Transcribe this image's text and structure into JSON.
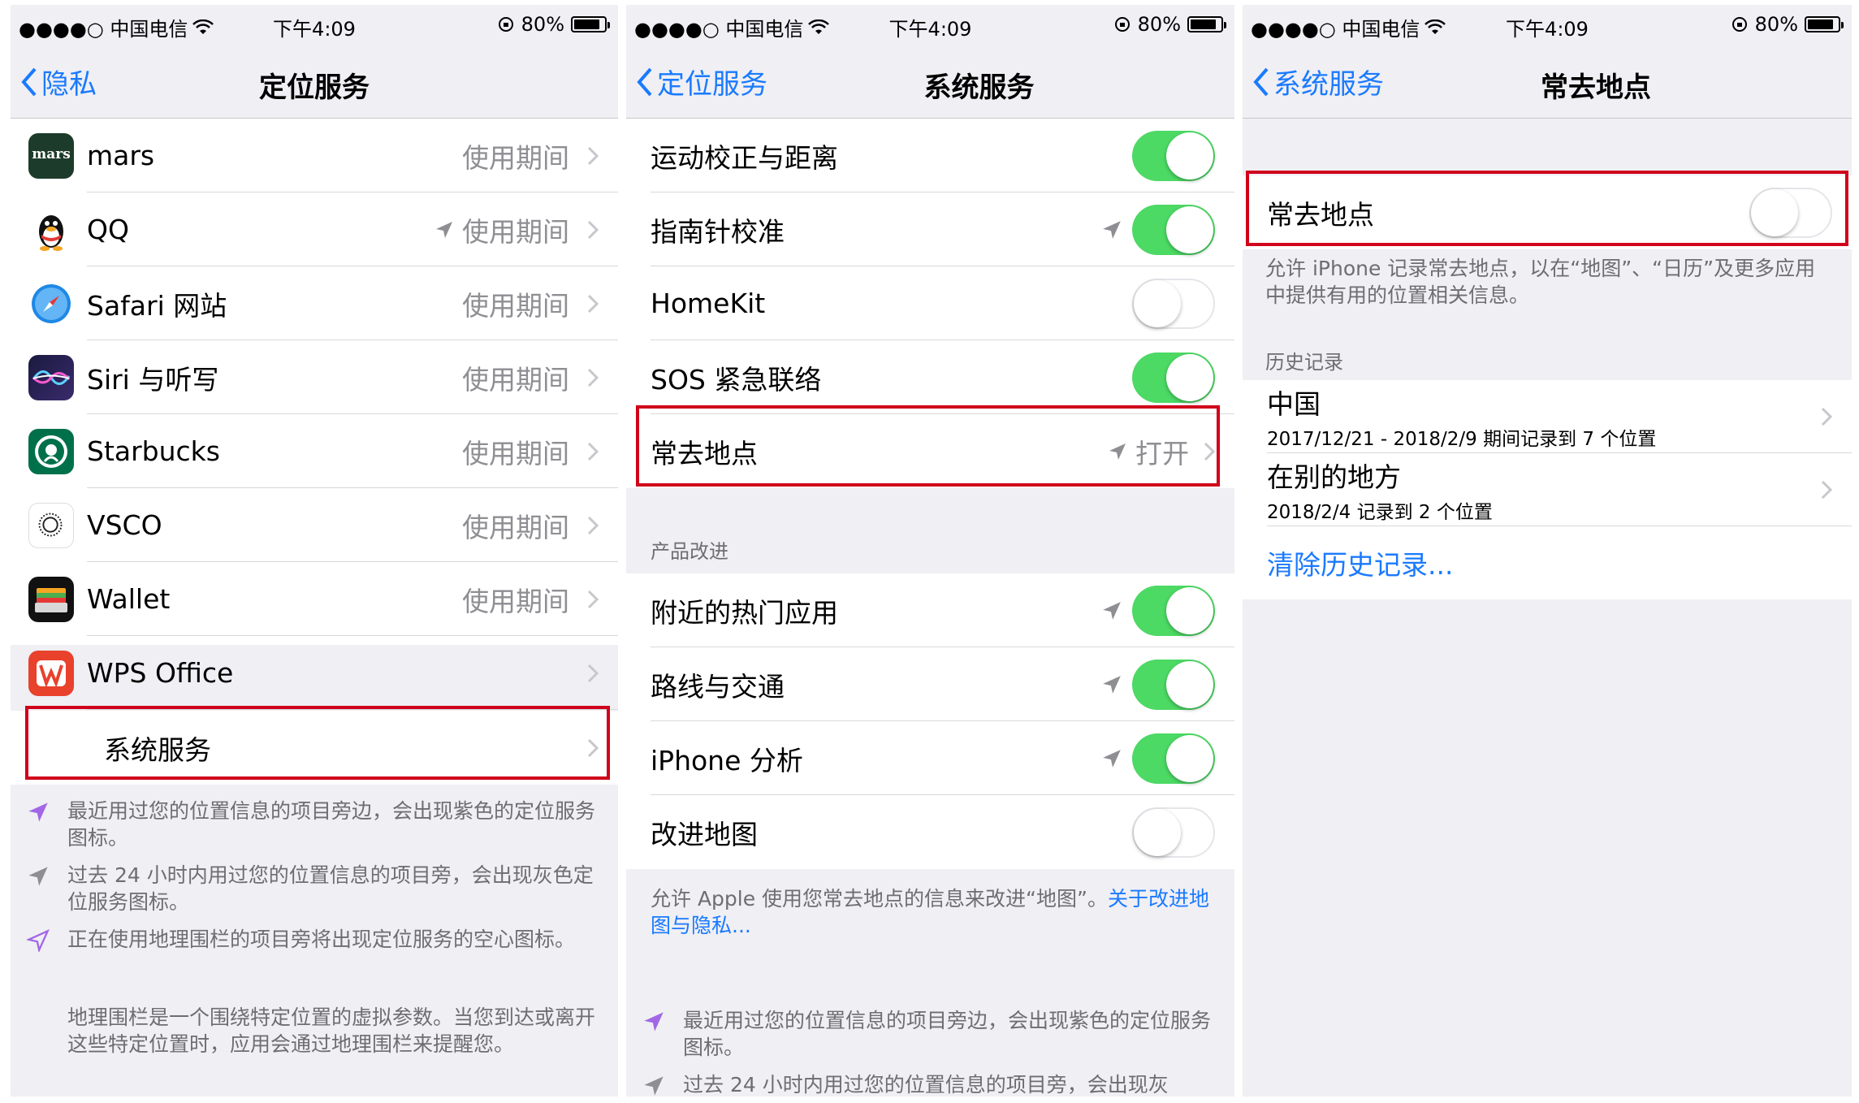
{
  "status": {
    "carrier": "●●●●○ 中国电信",
    "time": "下午4:09",
    "battery": "80%"
  },
  "panel1": {
    "back": "隐私",
    "title": "定位服务",
    "apps": [
      {
        "name": "mars",
        "value": "使用期间",
        "recent": false
      },
      {
        "name": "QQ",
        "value": "使用期间",
        "recent": true
      },
      {
        "name": "Safari 网站",
        "value": "使用期间",
        "recent": false
      },
      {
        "name": "Siri 与听写",
        "value": "使用期间",
        "recent": false
      },
      {
        "name": "Starbucks",
        "value": "使用期间",
        "recent": false
      },
      {
        "name": "VSCO",
        "value": "使用期间",
        "recent": false
      },
      {
        "name": "Wallet",
        "value": "使用期间",
        "recent": false
      },
      {
        "name": "WPS Office",
        "value": "",
        "recent": false
      }
    ],
    "mars_icon_text": "mars",
    "system_services": "系统服务",
    "notes": [
      "最近用过您的位置信息的项目旁边，会出现紫色的定位服务图标。",
      "过去 24 小时内用过您的位置信息的项目旁，会出现灰色定位服务图标。",
      "正在使用地理围栏的项目旁将出现定位服务的空心图标。"
    ],
    "geofence_note": "地理围栏是一个围绕特定位置的虚拟参数。当您到达或离开这些特定位置时，应用会通过地理围栏来提醒您。"
  },
  "panel2": {
    "back": "定位服务",
    "title": "系统服务",
    "rows1": [
      {
        "label": "运动校正与距离",
        "on": true,
        "loc": false
      },
      {
        "label": "指南针校准",
        "on": true,
        "loc": true
      },
      {
        "label": "HomeKit",
        "on": false,
        "loc": false
      },
      {
        "label": "SOS 紧急联络",
        "on": true,
        "loc": false
      }
    ],
    "frequent": {
      "label": "常去地点",
      "value": "打开"
    },
    "section": "产品改进",
    "rows2": [
      {
        "label": "附近的热门应用",
        "on": true,
        "loc": true
      },
      {
        "label": "路线与交通",
        "on": true,
        "loc": true
      },
      {
        "label": "iPhone 分析",
        "on": true,
        "loc": true
      },
      {
        "label": "改进地图",
        "on": false,
        "loc": false
      }
    ],
    "footer_text": "允许 Apple 使用您常去地点的信息来改进“地图”。",
    "footer_link": "关于改进地图与隐私...",
    "notes": [
      "最近用过您的位置信息的项目旁边，会出现紫色的定位服务图标。",
      "过去 24 小时内用过您的位置信息的项目旁，会出现灰"
    ]
  },
  "panel3": {
    "back": "系统服务",
    "title": "常去地点",
    "toggle_label": "常去地点",
    "toggle_on": false,
    "description": "允许 iPhone 记录常去地点，以在“地图”、“日历”及更多应用中提供有用的位置相关信息。",
    "history_header": "历史记录",
    "history": [
      {
        "title": "中国",
        "detail": "2017/12/21 - 2018/2/9 期间记录到 7 个位置"
      },
      {
        "title": "在别的地方",
        "detail": "2018/2/4 记录到 2 个位置"
      }
    ],
    "clear": "清除历史记录..."
  },
  "colors": {
    "accent": "#1a7aff",
    "toggle_on": "#4cd964",
    "highlight": "#d0021b",
    "purple_arrow": "#a267e6",
    "gray_arrow": "#8e8e93"
  }
}
